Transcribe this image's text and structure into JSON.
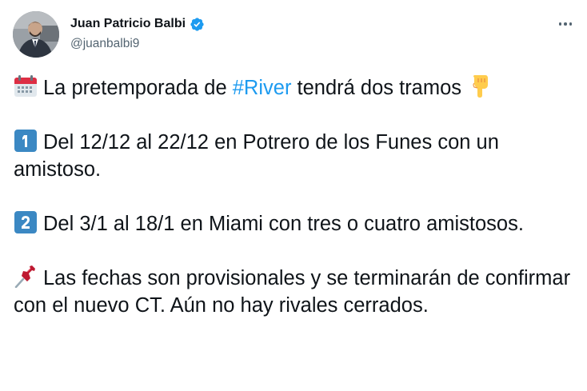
{
  "author": {
    "display_name": "Juan Patricio Balbi",
    "handle": "@juanbalbi9",
    "verified": true
  },
  "menu": {
    "icon": "more-horizontal-icon"
  },
  "tweet": {
    "p1": {
      "icon": "calendar-icon",
      "pre": "La pretemporada de ",
      "hashtag": "#River",
      "post": " tendrá dos tramos",
      "trail_icon": "backhand-index-pointing-down-icon"
    },
    "p2": {
      "icon": "keycap-1-icon",
      "text": "Del 12/12 al 22/12 en Potrero de los Funes con un amistoso."
    },
    "p3": {
      "icon": "keycap-2-icon",
      "text": "Del 3/1 al 18/1 en Miami con tres o cuatro amistosos."
    },
    "p4": {
      "icon": "pushpin-icon",
      "text": "Las fechas son provisionales y se terminarán de confirmar con el nuevo CT. Aún no hay rivales cerrados."
    }
  },
  "colors": {
    "text": "#0f1419",
    "secondary": "#536471",
    "link": "#1d9bf0",
    "verified": "#1d9bf0",
    "keycap": "#3b88c3",
    "pin": "#be1931"
  }
}
